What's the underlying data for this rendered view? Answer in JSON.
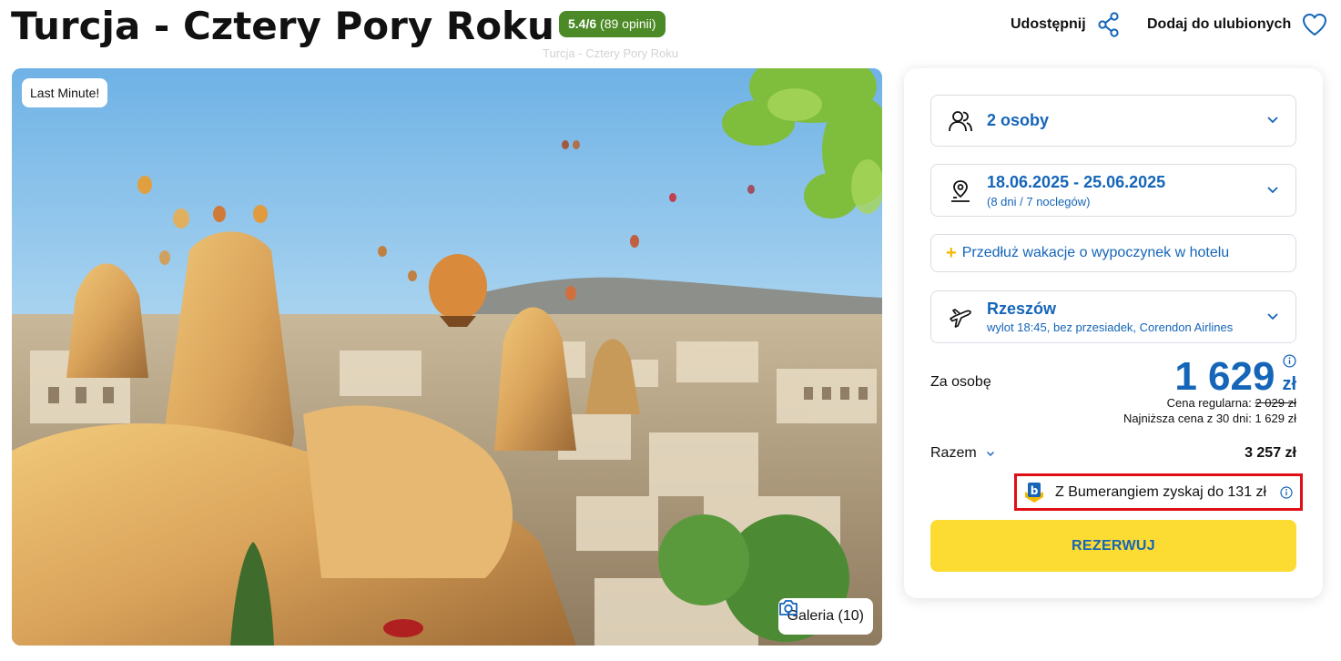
{
  "header": {
    "title": "Turcja - Cztery Pory Roku",
    "rating_score": "5.4/6",
    "rating_reviews": "(89 opinii)",
    "subtitle_faint": "Turcja - Cztery Pory Roku",
    "share_label": "Udostępnij",
    "favorite_label": "Dodaj do ulubionych",
    "rating_color": "#4b8a26"
  },
  "photo": {
    "badge": "Last Minute!",
    "gallery_label": "Galeria (10)"
  },
  "booking": {
    "persons": "2 osoby",
    "dates": "18.06.2025 - 25.06.2025",
    "dates_sub": "(8 dni / 7 noclegów)",
    "extend_label": "Przedłuż wakacje o wypoczynek w hotelu",
    "departure_city": "Rzeszów",
    "departure_sub": "wylot 18:45, bez przesiadek, Corendon Airlines",
    "per_person_label": "Za osobę",
    "price_amount": "1 629",
    "price_currency": "zł",
    "regular_price_label": "Cena regularna:",
    "regular_price_value": "2 029 zł",
    "lowest_price_text": "Najniższa cena z 30 dni: 1 629 zł",
    "total_label": "Razem",
    "total_value": "3 257 zł",
    "bumerang_text": "Z Bumerangiem zyskaj do 131 zł",
    "reserve_label": "REZERWUJ",
    "accent_color": "#1565b8",
    "button_color": "#fcdb32",
    "highlight_color": "#e00f16"
  }
}
